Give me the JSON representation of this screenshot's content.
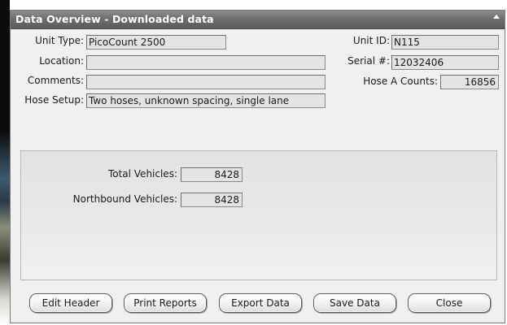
{
  "window": {
    "title": "Data Overview - Downloaded data"
  },
  "header": {
    "unit_type_label": "Unit Type:",
    "unit_type_value": "PicoCount 2500",
    "location_label": "Location:",
    "location_value": "",
    "comments_label": "Comments:",
    "comments_value": "",
    "hose_setup_label": "Hose Setup:",
    "hose_setup_value": "Two hoses, unknown spacing, single lane",
    "unit_id_label": "Unit ID:",
    "unit_id_value": "N115",
    "serial_label": "Serial #:",
    "serial_value": "12032406",
    "hose_a_label": "Hose A Counts:",
    "hose_a_value": "16856"
  },
  "summary": {
    "total_label": "Total Vehicles:",
    "total_value": "8428",
    "northbound_label": "Northbound Vehicles:",
    "northbound_value": "8428"
  },
  "buttons": {
    "edit_header": "Edit Header",
    "print_reports": "Print Reports",
    "export_data": "Export Data",
    "save_data": "Save Data",
    "close": "Close"
  }
}
